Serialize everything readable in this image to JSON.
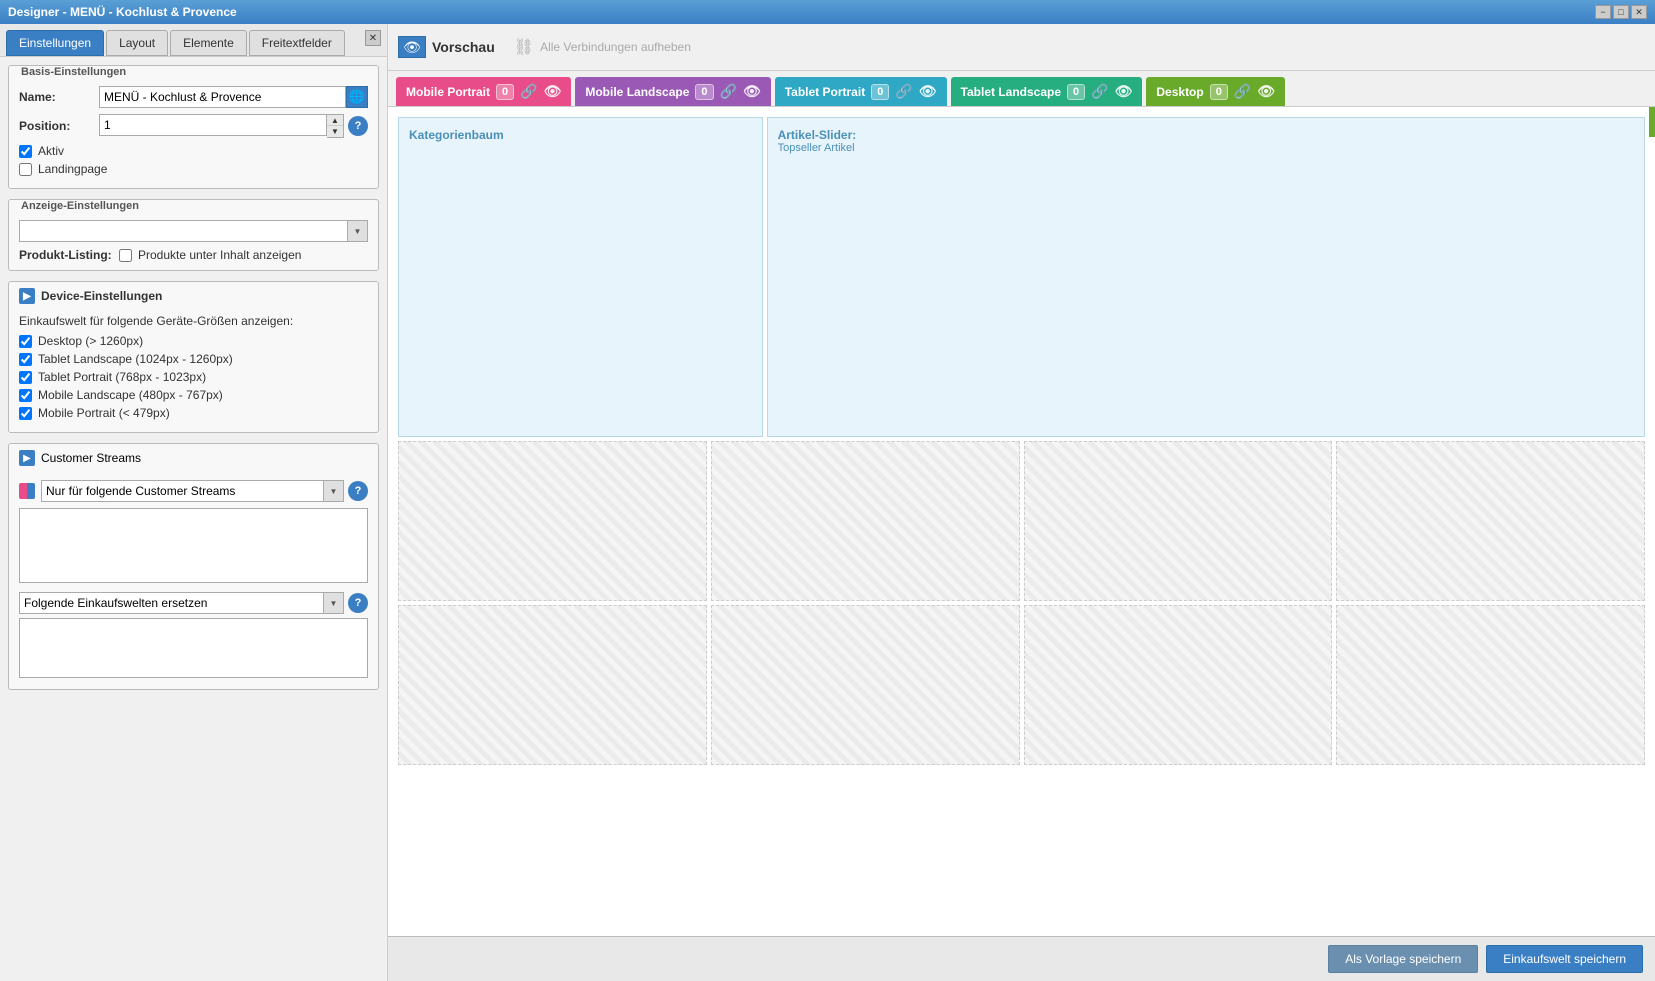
{
  "window": {
    "title": "Designer - MENÜ - Kochlust & Provence"
  },
  "titlebar_buttons": {
    "minimize": "−",
    "maximize": "□",
    "close": "✕"
  },
  "left_panel": {
    "close_btn": "✕",
    "tabs": [
      {
        "id": "einstellungen",
        "label": "Einstellungen",
        "active": true
      },
      {
        "id": "layout",
        "label": "Layout",
        "active": false
      },
      {
        "id": "elemente",
        "label": "Elemente",
        "active": false
      },
      {
        "id": "freitextfelder",
        "label": "Freitextfelder",
        "active": false
      }
    ],
    "basis_einstellungen": {
      "legend": "Basis-Einstellungen",
      "name_label": "Name:",
      "name_value": "MENÜ - Kochlust & Provence",
      "globe_icon": "🌐",
      "position_label": "Position:",
      "position_value": "1",
      "spinner_up": "▲",
      "spinner_down": "▼",
      "aktiv_label": "Aktiv",
      "aktiv_checked": true,
      "landingpage_label": "Landingpage",
      "landingpage_checked": false
    },
    "anzeige_einstellungen": {
      "legend": "Anzeige-Einstellungen",
      "dropdown_placeholder": "",
      "produkt_listing_label": "Produkt-Listing:",
      "produkt_listing_checkbox_label": "Produkte unter Inhalt anzeigen",
      "produkt_listing_checked": false
    },
    "device_einstellungen": {
      "legend": "Device-Einstellungen",
      "icon": "▶",
      "title": "Device-Einstellungen",
      "description": "Einkaufswelt für folgende Geräte-Größen anzeigen:",
      "devices": [
        {
          "id": "desktop",
          "label": "Desktop (> 1260px)",
          "checked": true
        },
        {
          "id": "tablet_landscape",
          "label": "Tablet Landscape (1024px - 1260px)",
          "checked": true
        },
        {
          "id": "tablet_portrait",
          "label": "Tablet Portrait (768px - 1023px)",
          "checked": true
        },
        {
          "id": "mobile_landscape",
          "label": "Mobile Landscape (480px - 767px)",
          "checked": true
        },
        {
          "id": "mobile_portrait",
          "label": "Mobile Portrait (< 479px)",
          "checked": true
        }
      ]
    },
    "customer_streams": {
      "icon": "▶",
      "title": "Customer Streams",
      "dropdown_placeholder": "Nur für folgende Customer Streams",
      "help_icon": "?",
      "textarea_value": "",
      "ersetzen_label": "Folgende Einkaufswelten ersetzen",
      "ersetzen_textarea_value": ""
    }
  },
  "right_panel": {
    "toolbar": {
      "preview_icon": "👁",
      "preview_label": "Vorschau",
      "disconnect_icon": "⛓",
      "disconnect_label": "Alle Verbindungen aufheben"
    },
    "device_tabs": [
      {
        "id": "mobile_portrait",
        "label": "Mobile Portrait",
        "badge": "0",
        "class": "mobile-portrait"
      },
      {
        "id": "mobile_landscape",
        "label": "Mobile Landscape",
        "badge": "0",
        "class": "mobile-landscape"
      },
      {
        "id": "tablet_portrait",
        "label": "Tablet Portrait",
        "badge": "0",
        "class": "tablet-portrait"
      },
      {
        "id": "tablet_landscape",
        "label": "Tablet Landscape",
        "badge": "0",
        "class": "tablet-landscape"
      },
      {
        "id": "desktop",
        "label": "Desktop",
        "badge": "0",
        "class": "desktop"
      }
    ],
    "canvas": {
      "block1": {
        "title": "Kategorienbaum",
        "subtitle": ""
      },
      "block2": {
        "title": "Artikel-Slider:",
        "subtitle": "Topseller Artikel"
      }
    },
    "bottom_bar": {
      "save_template_label": "Als Vorlage speichern",
      "save_world_label": "Einkaufswelt speichern"
    }
  }
}
